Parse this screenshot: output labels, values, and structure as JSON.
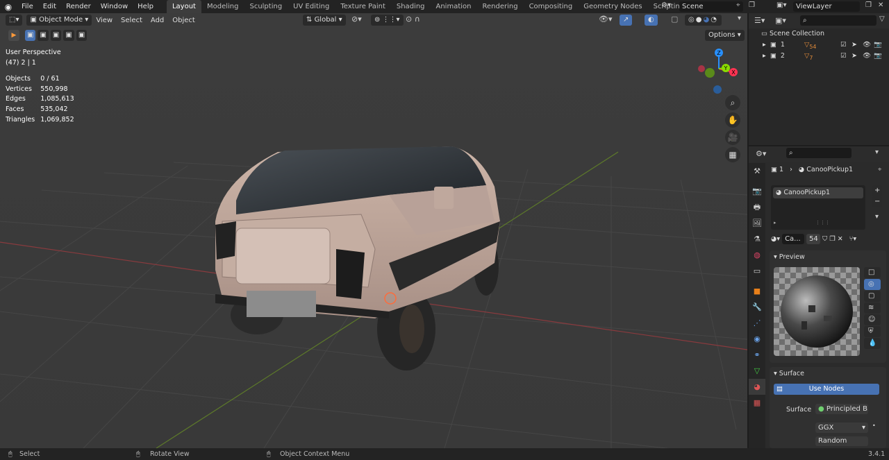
{
  "topbar": {
    "menus": [
      "File",
      "Edit",
      "Render",
      "Window",
      "Help"
    ],
    "workspaces": [
      "Layout",
      "Modeling",
      "Sculpting",
      "UV Editing",
      "Texture Paint",
      "Shading",
      "Animation",
      "Rendering",
      "Compositing",
      "Geometry Nodes",
      "Scripting"
    ],
    "active_workspace": "Layout",
    "add_tab": "+",
    "scene_value": "Scene",
    "view_layer_value": "ViewLayer"
  },
  "viewport": {
    "mode": "Object Mode",
    "menus": [
      "View",
      "Select",
      "Add",
      "Object"
    ],
    "transform_orientation": "Global",
    "options_label": "Options",
    "perspective_label": "User Perspective",
    "collection_label": "(47) 2 | 1",
    "stats": [
      {
        "label": "Objects",
        "value": "0 / 61"
      },
      {
        "label": "Vertices",
        "value": "550,998"
      },
      {
        "label": "Edges",
        "value": "1,085,613"
      },
      {
        "label": "Faces",
        "value": "535,042"
      },
      {
        "label": "Triangles",
        "value": "1,069,852"
      }
    ],
    "gizmo": {
      "x": "X",
      "y": "Y",
      "z": "Z"
    }
  },
  "outliner": {
    "root": "Scene Collection",
    "items": [
      {
        "label": "1",
        "badge": "54"
      },
      {
        "label": "2",
        "badge": "7"
      }
    ]
  },
  "properties": {
    "breadcrumb_index": "1",
    "object_name": "CanooPickup1",
    "material_slot": "CanooPickup1",
    "material_short": "Ca...",
    "user_count": "54",
    "preview_title": "Preview",
    "surface_title": "Surface",
    "use_nodes": "Use Nodes",
    "surface_label": "Surface",
    "surface_value": "Principled B...",
    "distribution": "GGX",
    "subsurface_method": "Random Walk"
  },
  "statusbar": {
    "select": "Select",
    "rotate": "Rotate View",
    "context": "Object Context Menu",
    "version": "3.4.1"
  },
  "colors": {
    "accent": "#4772b3",
    "x_axis": "#ff3352",
    "y_axis": "#8bdc00",
    "z_axis": "#2890ff",
    "panel_bg": "#303030"
  }
}
